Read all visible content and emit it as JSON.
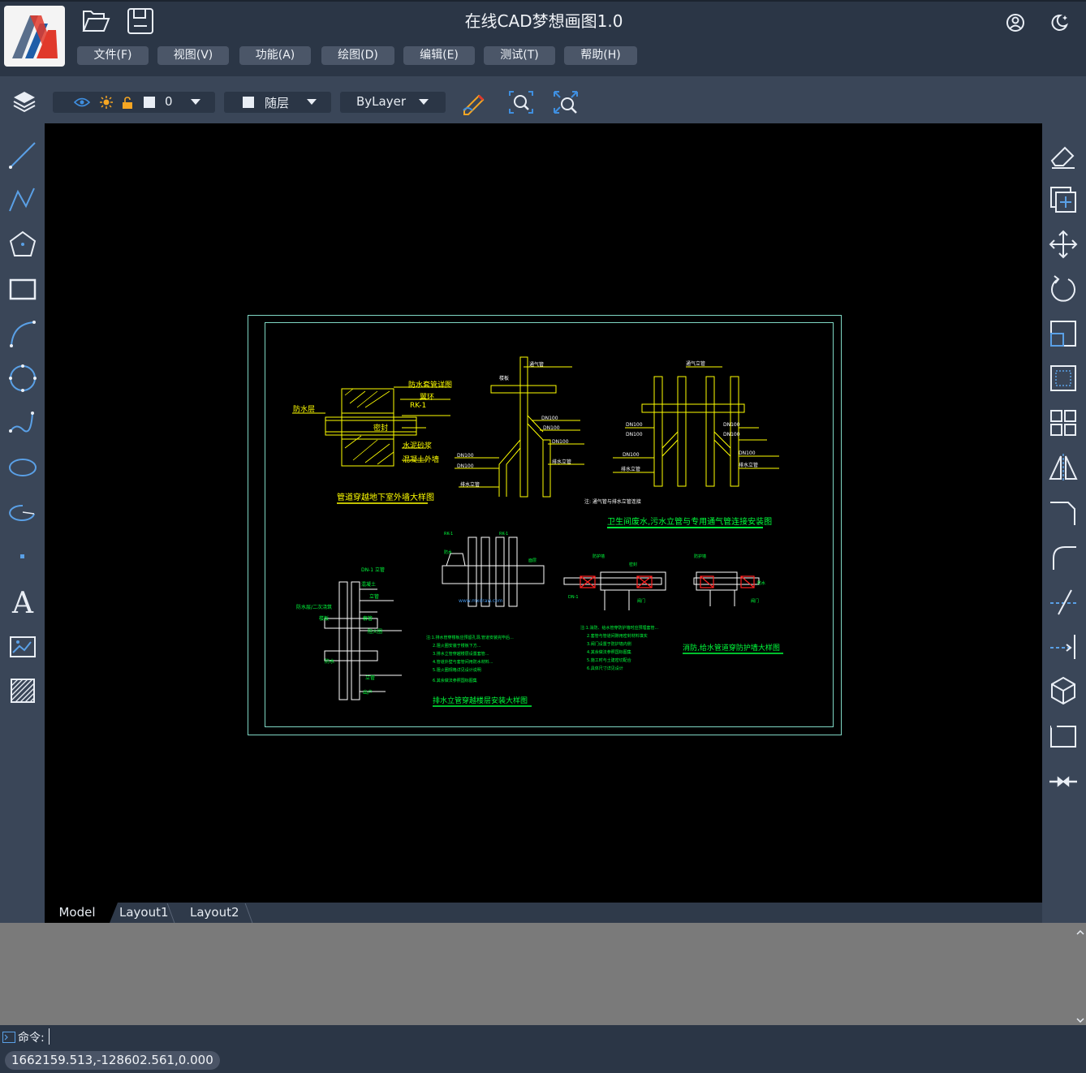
{
  "app": {
    "title": "在线CAD梦想画图1.0"
  },
  "menu": [
    {
      "label": "文件(F)"
    },
    {
      "label": "视图(V)"
    },
    {
      "label": "功能(A)"
    },
    {
      "label": "绘图(D)"
    },
    {
      "label": "编辑(E)"
    },
    {
      "label": "测试(T)"
    },
    {
      "label": "帮助(H)"
    }
  ],
  "toolbar": {
    "layer_name": "0",
    "color_value": "随层",
    "linetype_value": "ByLayer"
  },
  "tabs": [
    {
      "label": "Model",
      "active": true
    },
    {
      "label": "Layout1",
      "active": false
    },
    {
      "label": "Layout2",
      "active": false
    }
  ],
  "command": {
    "prompt": "命令:"
  },
  "status": {
    "coordinates": "1662159.513,-128602.561,0.000"
  },
  "drawing": {
    "titles": [
      "管道穿越地下室外墙大样图",
      "卫生间废水,污水立管与专用通气管连接安装图",
      "排水立管穿越楼层安装大样图",
      "消防,给水管道穿防护墙大样图"
    ],
    "labels": {
      "rk1": "RK-1"
    }
  },
  "colors": {
    "header_bg": "#2b3646",
    "toolbar_bg": "#3a4658",
    "canvas_bg": "#000000",
    "menu_button": "#4b5668",
    "command_history_bg": "#7a7a7a",
    "drawing_yellow": "#ffff00",
    "drawing_green": "#00ff3c",
    "drawing_cyan": "#7fd7c4"
  },
  "icons": {
    "left_tools": [
      "line-icon",
      "polyline-icon",
      "polygon-icon",
      "rectangle-icon",
      "arc-icon",
      "circle-icon",
      "spline-icon",
      "ellipse-icon",
      "ellipse-arc-icon",
      "point-icon",
      "text-icon",
      "image-icon",
      "hatch-icon"
    ],
    "right_tools": [
      "erase-icon",
      "copy-icon",
      "move-icon",
      "rotate-icon",
      "scale-icon",
      "select-window-icon",
      "array-icon",
      "mirror-icon",
      "fillet-icon",
      "chamfer-icon",
      "trim-icon",
      "extend-icon",
      "3d-box-icon",
      "offset-icon",
      "join-icon"
    ]
  }
}
